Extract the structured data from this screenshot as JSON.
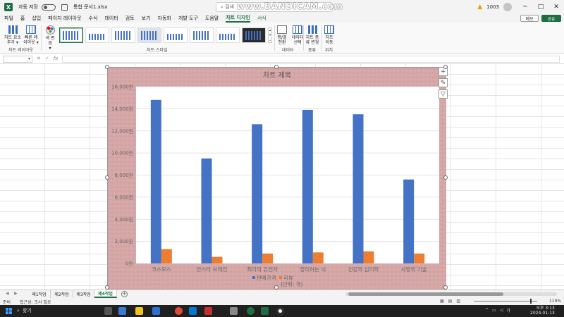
{
  "titlebar": {
    "autosave_label": "자동 저장",
    "filename": "통합 문서1.xlsx",
    "search_placeholder": "검색",
    "watermark": "www.BANDICAM.com",
    "user_text": "1003",
    "win_min": "─",
    "win_max": "□",
    "win_close": "✕"
  },
  "menu": {
    "tabs": [
      "파일",
      "홈",
      "삽입",
      "페이지 레이아웃",
      "수식",
      "데이터",
      "검토",
      "보기",
      "자동화",
      "개발 도구",
      "도움말",
      "차트 디자인",
      "서식"
    ],
    "active_index": 11,
    "memo_label": "메모",
    "share_label": "공유"
  },
  "ribbon": {
    "add_element": "차트 요소\n추가 ▾",
    "quick_layout": "빠른 레\n이아웃 ▾",
    "change_color": "색 변경\n▾",
    "layout_group": "차트 레이아웃",
    "styles_group": "차트 스타일",
    "switch_rowcol": "행/열\n전환",
    "select_data": "데이터\n선택",
    "data_group": "데이터",
    "change_type": "차트 종\n류 변경",
    "type_group": "종류",
    "move_chart": "차트\n이동",
    "location_group": "위치"
  },
  "formulabar": {
    "namebox": "",
    "fx": "fx",
    "cancel": "✕",
    "enter": "✓",
    "value": ""
  },
  "chart_data": {
    "type": "bar",
    "title": "차트 제목",
    "categories": [
      "코스모스",
      "안스타 브레인",
      "최리의 유전자",
      "정리하는 뇌",
      "건강의 심리학",
      "사랑의 기술"
    ],
    "series": [
      {
        "name": "판매가격",
        "color": "#4472c4",
        "values": [
          14800,
          9500,
          12600,
          13900,
          13500,
          7600
        ]
      },
      {
        "name": "리뷰\n(단위: 개)",
        "color": "#ed7d31",
        "values": [
          1300,
          600,
          900,
          1000,
          1100,
          900
        ]
      }
    ],
    "ylim": [
      0,
      16000
    ],
    "ytick_labels": [
      "0원",
      "2,000원",
      "4,000원",
      "6,000원",
      "8,000원",
      "10,000원",
      "12,000원",
      "14,000원",
      "16,000원"
    ],
    "legend_position": "bottom",
    "grid": true,
    "chart_bg": "#d6a7a7",
    "plot_bg": "#ffffff"
  },
  "chart_tools": {
    "add": "+",
    "brush": "✎",
    "filter": "▽"
  },
  "sheets": {
    "names": [
      "제1작업",
      "제2작업",
      "제3작업",
      "제4작업"
    ],
    "active_index": 3,
    "add": "+",
    "nav_prev": "◀",
    "nav_next": "▶"
  },
  "statusbar": {
    "ready": "준비",
    "accessibility": "접근성: 조사 필요",
    "zoom": "119%"
  },
  "taskbar": {
    "search_label": "찾기",
    "tray_lang": "가",
    "time": "오후 3:13",
    "date": "2024-01-13"
  }
}
